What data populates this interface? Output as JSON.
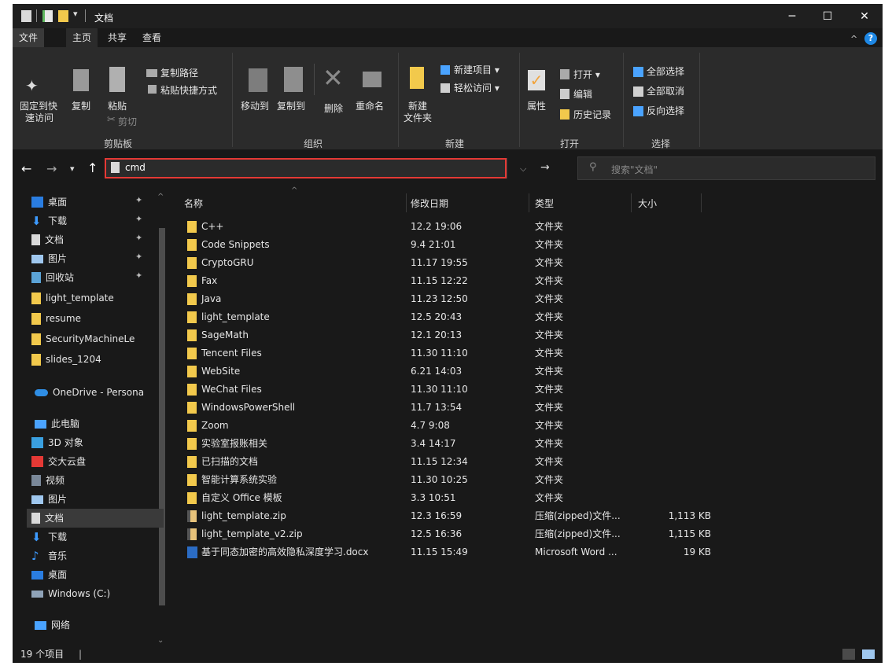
{
  "title": "文档",
  "window_controls": {
    "minimize": "─",
    "maximize": "☐",
    "close": "✕"
  },
  "tabs": [
    {
      "label": "文件"
    },
    {
      "label": "主页"
    },
    {
      "label": "共享"
    },
    {
      "label": "查看"
    }
  ],
  "help": "?",
  "ribbon": {
    "clipboard": {
      "pin_label_1": "固定到快",
      "pin_label_2": "速访问",
      "copy": "复制",
      "paste": "粘贴",
      "copy_path": "复制路径",
      "paste_shortcut": "粘贴快捷方式",
      "cut": "剪切",
      "group": "剪贴板"
    },
    "organize": {
      "move_to": "移动到",
      "copy_to": "复制到",
      "delete": "删除",
      "rename": "重命名",
      "group": "组织"
    },
    "new": {
      "new_item": "新建项目 ▾",
      "easy_access": "轻松访问 ▾",
      "new_folder_1": "新建",
      "new_folder_2": "文件夹",
      "group": "新建"
    },
    "open": {
      "properties": "属性",
      "open": "打开 ▾",
      "edit": "编辑",
      "history": "历史记录",
      "group": "打开"
    },
    "select": {
      "select_all": "全部选择",
      "select_none": "全部取消",
      "invert": "反向选择",
      "group": "选择"
    }
  },
  "address": {
    "value": "cmd",
    "search_placeholder": "搜索\"文档\""
  },
  "nav": {
    "quick_access": [
      {
        "label": "桌面",
        "pinned": true
      },
      {
        "label": "下载",
        "pinned": true
      },
      {
        "label": "文档",
        "pinned": true
      },
      {
        "label": "图片",
        "pinned": true
      },
      {
        "label": "回收站",
        "pinned": true
      },
      {
        "label": "light_template"
      },
      {
        "label": "resume"
      },
      {
        "label": "SecurityMachineLe"
      },
      {
        "label": "slides_1204"
      }
    ],
    "onedrive": "OneDrive - Persona",
    "this_pc": "此电脑",
    "pc_items": [
      {
        "label": "3D 对象"
      },
      {
        "label": "交大云盘"
      },
      {
        "label": "视频"
      },
      {
        "label": "图片"
      },
      {
        "label": "文档"
      },
      {
        "label": "下载"
      },
      {
        "label": "音乐"
      },
      {
        "label": "桌面"
      },
      {
        "label": "Windows (C:)"
      }
    ],
    "network": "网络"
  },
  "columns": {
    "name": "名称",
    "date": "修改日期",
    "type": "类型",
    "size": "大小"
  },
  "files": [
    {
      "name": "C++",
      "date": "12.2 19:06",
      "type": "文件夹",
      "size": "",
      "kind": "folder"
    },
    {
      "name": "Code Snippets",
      "date": "9.4 21:01",
      "type": "文件夹",
      "size": "",
      "kind": "folder"
    },
    {
      "name": "CryptoGRU",
      "date": "11.17 19:55",
      "type": "文件夹",
      "size": "",
      "kind": "folder"
    },
    {
      "name": "Fax",
      "date": "11.15 12:22",
      "type": "文件夹",
      "size": "",
      "kind": "folder"
    },
    {
      "name": "Java",
      "date": "11.23 12:50",
      "type": "文件夹",
      "size": "",
      "kind": "folder"
    },
    {
      "name": "light_template",
      "date": "12.5 20:43",
      "type": "文件夹",
      "size": "",
      "kind": "folder"
    },
    {
      "name": "SageMath",
      "date": "12.1 20:13",
      "type": "文件夹",
      "size": "",
      "kind": "folder"
    },
    {
      "name": "Tencent Files",
      "date": "11.30 11:10",
      "type": "文件夹",
      "size": "",
      "kind": "folder"
    },
    {
      "name": "WebSite",
      "date": "6.21 14:03",
      "type": "文件夹",
      "size": "",
      "kind": "folder"
    },
    {
      "name": "WeChat Files",
      "date": "11.30 11:10",
      "type": "文件夹",
      "size": "",
      "kind": "folder"
    },
    {
      "name": "WindowsPowerShell",
      "date": "11.7 13:54",
      "type": "文件夹",
      "size": "",
      "kind": "folder"
    },
    {
      "name": "Zoom",
      "date": "4.7 9:08",
      "type": "文件夹",
      "size": "",
      "kind": "folder"
    },
    {
      "name": "实验室报账相关",
      "date": "3.4 14:17",
      "type": "文件夹",
      "size": "",
      "kind": "folder"
    },
    {
      "name": "已扫描的文档",
      "date": "11.15 12:34",
      "type": "文件夹",
      "size": "",
      "kind": "folder"
    },
    {
      "name": "智能计算系统实验",
      "date": "11.30 10:25",
      "type": "文件夹",
      "size": "",
      "kind": "folder"
    },
    {
      "name": "自定义 Office 模板",
      "date": "3.3 10:51",
      "type": "文件夹",
      "size": "",
      "kind": "folder"
    },
    {
      "name": "light_template.zip",
      "date": "12.3 16:59",
      "type": "压缩(zipped)文件...",
      "size": "1,113 KB",
      "kind": "zip"
    },
    {
      "name": "light_template_v2.zip",
      "date": "12.5 16:36",
      "type": "压缩(zipped)文件...",
      "size": "1,115 KB",
      "kind": "zip"
    },
    {
      "name": "基于同态加密的高效隐私深度学习.docx",
      "date": "11.15 15:49",
      "type": "Microsoft Word ...",
      "size": "19 KB",
      "kind": "docx"
    }
  ],
  "status": {
    "count": "19 个项目",
    "cursor": "|"
  }
}
